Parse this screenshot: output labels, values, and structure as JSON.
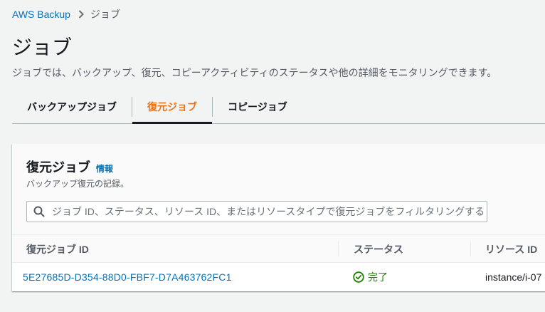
{
  "breadcrumb": {
    "root": "AWS Backup",
    "current": "ジョブ"
  },
  "header": {
    "title": "ジョブ",
    "description": "ジョブでは、バックアップ、復元、コピーアクティビティのステータスや他の詳細をモニタリングできます。"
  },
  "tabs": [
    {
      "label": "バックアップジョブ",
      "active": false
    },
    {
      "label": "復元ジョブ",
      "active": true
    },
    {
      "label": "コピージョブ",
      "active": false
    }
  ],
  "restore_jobs": {
    "title": "復元ジョブ",
    "info": "情報",
    "description": "バックアップ復元の記録。",
    "search": {
      "placeholder": "ジョブ ID、ステータス、リソース ID、またはリソースタイプで復元ジョブをフィルタリングする",
      "value": ""
    },
    "columns": [
      "復元ジョブ ID",
      "ステータス",
      "リソース ID"
    ],
    "rows": [
      {
        "job_id": "5E27685D-D354-88D0-FBF7-D7A463762FC1",
        "status": "完了",
        "resource_id": "instance/i-07"
      }
    ]
  },
  "colors": {
    "accent": "#ec7211",
    "link": "#0073bb",
    "success": "#1d8102"
  },
  "icons": {
    "breadcrumb_separator": "chevron-right-icon",
    "search": "search-icon",
    "status": "status-success-icon"
  }
}
